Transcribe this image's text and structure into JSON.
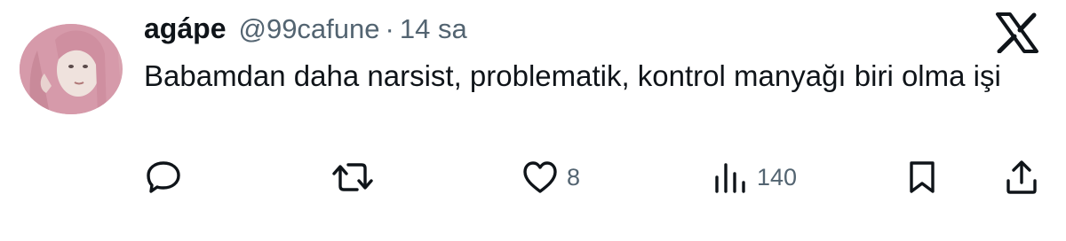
{
  "tweet": {
    "author_name": "agápe",
    "handle": "@99cafune",
    "separator": "·",
    "time": "14 sa",
    "text": "Babamdan daha narsist, problematik, kontrol manyağı biri olma işi"
  },
  "actions": {
    "reply_icon": "reply-icon",
    "retweet_icon": "retweet-icon",
    "like_icon": "heart-icon",
    "like_count": "8",
    "views_icon": "views-icon",
    "views_count": "140",
    "bookmark_icon": "bookmark-icon",
    "share_icon": "share-icon"
  },
  "colors": {
    "text": "#0f1419",
    "secondary": "#536471",
    "avatar_hair": "#d8a1ae"
  }
}
